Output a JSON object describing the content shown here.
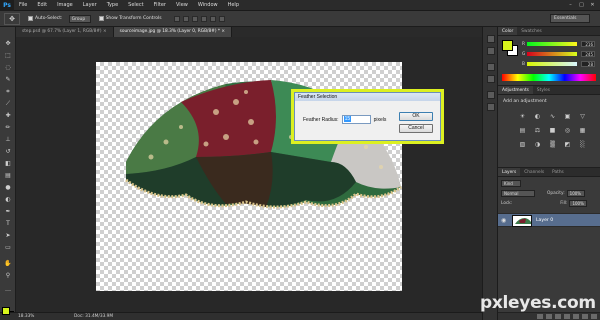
{
  "app": {
    "logo": "Ps"
  },
  "menu": [
    "File",
    "Edit",
    "Image",
    "Layer",
    "Type",
    "Select",
    "Filter",
    "View",
    "Window",
    "Help"
  ],
  "window_controls": [
    "–",
    "□",
    "✕"
  ],
  "options": {
    "tool_icon": "move-icon",
    "auto_select_label": "Auto-Select:",
    "auto_select_value": "Group",
    "show_transform_label": "Show Transform Controls",
    "workspace": "Essentials"
  },
  "tabs": [
    {
      "label": "step.psd @ 67.7% (Layer 1, RGB/8#) ×",
      "active": false
    },
    {
      "label": "sourceimage.jpg @ 18.3% (Layer 0, RGB/8#) * ×",
      "active": true
    }
  ],
  "status": {
    "zoom": "18.33%",
    "doc": "Doc: 31.4M/33.9M"
  },
  "color_panel": {
    "tabs": [
      "Color",
      "Swatches"
    ],
    "foreground": "#d8f51c",
    "background": "#ffffff",
    "sliders": [
      {
        "label": "R",
        "value": "216",
        "gradient": "linear-gradient(to right,#00f51c,#fff51c)"
      },
      {
        "label": "G",
        "value": "245",
        "gradient": "linear-gradient(to right,#d8001c,#d8ff1c)"
      },
      {
        "label": "B",
        "value": "28",
        "gradient": "linear-gradient(to right,#d8f500,#d8f5ff)"
      }
    ]
  },
  "adjustments": {
    "tabs": [
      "Adjustments",
      "Styles"
    ],
    "title": "Add an adjustment",
    "icons": [
      "☀",
      "◐",
      "∿",
      "▣",
      "▽",
      "▤",
      "⚖",
      "■",
      "◎",
      "▦",
      "▧",
      "◑",
      "▒",
      "◩",
      "░"
    ]
  },
  "layers": {
    "tabs": [
      "Layers",
      "Channels",
      "Paths"
    ],
    "kind": "Kind",
    "blend": "Normal",
    "opacity_label": "Opacity:",
    "opacity": "100%",
    "lock_label": "Lock:",
    "fill_label": "Fill:",
    "fill": "100%",
    "layer_name": "Layer 0"
  },
  "dialog": {
    "title": "Feather Selection",
    "radius_label": "Feather Radius:",
    "radius_value": "15",
    "unit": "pixels",
    "ok": "OK",
    "cancel": "Cancel"
  },
  "watermark": "pxleyes.com"
}
